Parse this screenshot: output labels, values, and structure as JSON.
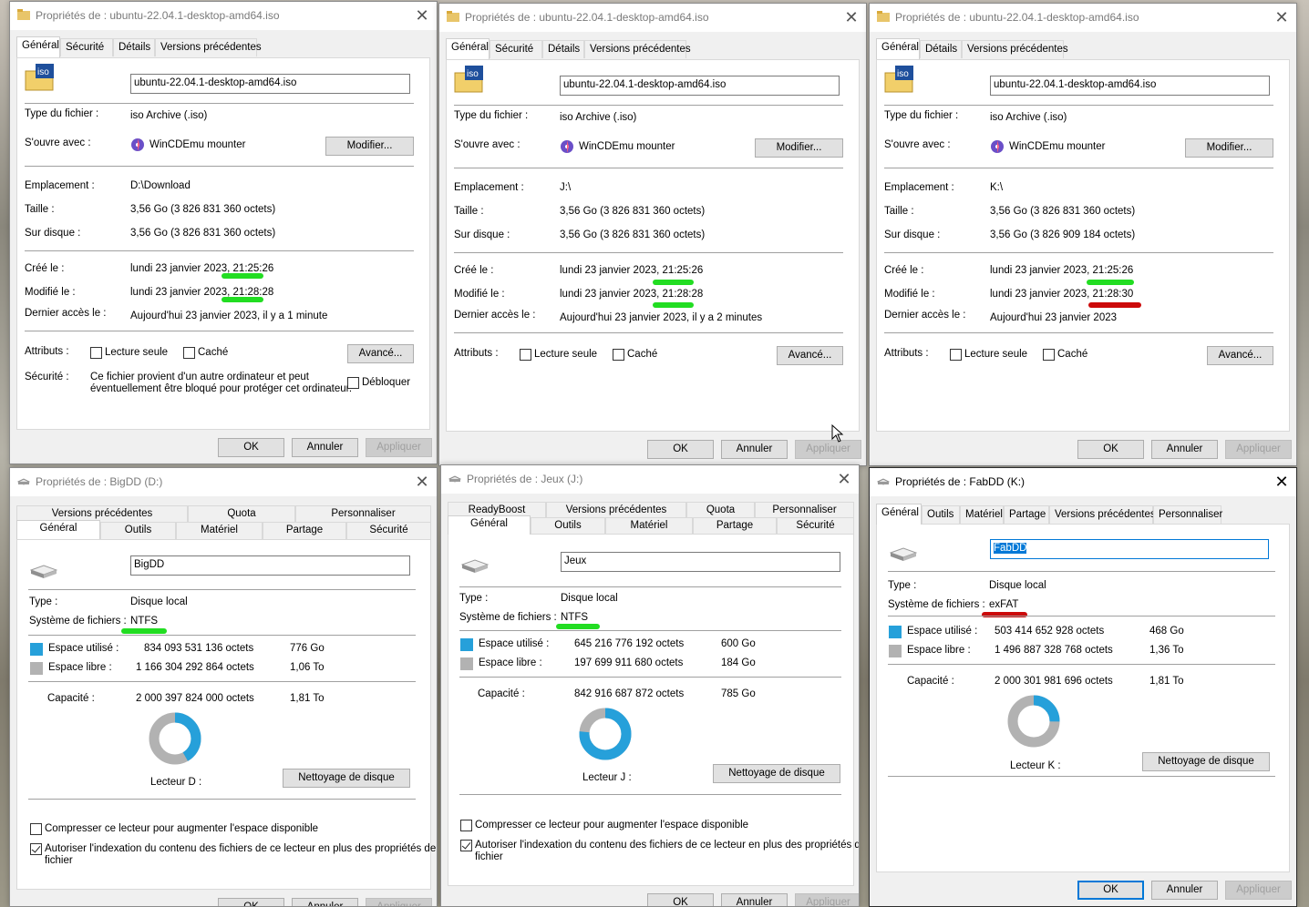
{
  "colors": {
    "used": "#26a0da",
    "free": "#b2b2b2",
    "highlight_green": "#22dd22",
    "highlight_red": "#cc0a0a",
    "focus": "#0078d7"
  },
  "labels": {
    "type_fichier": "Type du fichier :",
    "souvre_avec": "S'ouvre avec :",
    "emplacement": "Emplacement :",
    "taille": "Taille :",
    "sur_disque": "Sur disque :",
    "cree": "Créé le :",
    "modifie": "Modifié le :",
    "dernier_acces": "Dernier accès le :",
    "attributs": "Attributs :",
    "securite": "Sécurité :",
    "lecture_seule": "Lecture seule",
    "cache": "Caché",
    "avance": "Avancé...",
    "modifier": "Modifier...",
    "debloquer": "Débloquer",
    "type": "Type :",
    "systeme_fichiers": "Système de fichiers :",
    "espace_utilise": "Espace utilisé :",
    "espace_libre": "Espace libre :",
    "capacite": "Capacité :",
    "nettoyage": "Nettoyage de disque",
    "compresser": "Compresser ce lecteur pour augmenter l'espace disponible",
    "autoriser_1": "Autoriser l'indexation du contenu des fichiers de ce lecteur en plus des propriétés de",
    "autoriser_2": "fichier",
    "ok": "OK",
    "annuler": "Annuler",
    "appliquer": "Appliquer"
  },
  "file_windows": [
    {
      "title": "Propriétés de : ubuntu-22.04.1-desktop-amd64.iso",
      "tabs": [
        "Général",
        "Sécurité",
        "Détails",
        "Versions précédentes"
      ],
      "name": "ubuntu-22.04.1-desktop-amd64.iso",
      "type": "iso Archive (.iso)",
      "opens_with": "WinCDEmu mounter",
      "location": "D:\\Download",
      "size": "3,56 Go (3 826 831 360 octets)",
      "on_disk": "3,56 Go (3 826 831 360 octets)",
      "created": "lundi 23 janvier 2023, 21:25:26",
      "modified": "lundi 23 janvier 2023, 21:28:28",
      "accessed": "Aujourd'hui 23 janvier 2023, il y a 1 minute",
      "security_1": "Ce fichier provient d'un autre ordinateur et peut",
      "security_2": "éventuellement être bloqué pour protéger cet ordinateur."
    },
    {
      "title": "Propriétés de : ubuntu-22.04.1-desktop-amd64.iso",
      "tabs": [
        "Général",
        "Sécurité",
        "Détails",
        "Versions précédentes"
      ],
      "name": "ubuntu-22.04.1-desktop-amd64.iso",
      "type": "iso Archive (.iso)",
      "opens_with": "WinCDEmu mounter",
      "location": "J:\\",
      "size": "3,56 Go (3 826 831 360 octets)",
      "on_disk": "3,56 Go (3 826 831 360 octets)",
      "created": "lundi 23 janvier 2023, 21:25:26",
      "modified": "lundi 23 janvier 2023, 21:28:28",
      "accessed": "Aujourd'hui 23 janvier 2023, il y a 2 minutes"
    },
    {
      "title": "Propriétés de : ubuntu-22.04.1-desktop-amd64.iso",
      "tabs": [
        "Général",
        "Détails",
        "Versions précédentes"
      ],
      "name": "ubuntu-22.04.1-desktop-amd64.iso",
      "type": "iso Archive (.iso)",
      "opens_with": "WinCDEmu mounter",
      "location": "K:\\",
      "size": "3,56 Go (3 826 831 360 octets)",
      "on_disk": "3,56 Go (3 826 909 184 octets)",
      "created": "lundi 23 janvier 2023, 21:25:26",
      "modified": "lundi 23 janvier 2023, 21:28:30",
      "accessed": "Aujourd'hui 23 janvier 2023"
    }
  ],
  "drive_windows": [
    {
      "title": "Propriétés de : BigDD (D:)",
      "tabs_row1": [
        "Versions précédentes",
        "Quota",
        "Personnaliser"
      ],
      "tabs_row2": [
        "Général",
        "Outils",
        "Matériel",
        "Partage",
        "Sécurité"
      ],
      "name": "BigDD",
      "type": "Disque local",
      "fs": "NTFS",
      "used_bytes": "834 093 531 136 octets",
      "used_h": "776 Go",
      "free_bytes": "1 166 304 292 864 octets",
      "free_h": "1,06 To",
      "cap_bytes": "2 000 397 824 000 octets",
      "cap_h": "1,81 To",
      "used_fraction": 0.417,
      "drive_label": "Lecteur D :"
    },
    {
      "title": "Propriétés de : Jeux (J:)",
      "tabs_row1": [
        "ReadyBoost",
        "Versions précédentes",
        "Quota",
        "Personnaliser"
      ],
      "tabs_row2": [
        "Général",
        "Outils",
        "Matériel",
        "Partage",
        "Sécurité"
      ],
      "name": "Jeux",
      "type": "Disque local",
      "fs": "NTFS",
      "used_bytes": "645 216 776 192 octets",
      "used_h": "600 Go",
      "free_bytes": "197 699 911 680 octets",
      "free_h": "184 Go",
      "cap_bytes": "842 916 687 872 octets",
      "cap_h": "785 Go",
      "used_fraction": 0.765,
      "drive_label": "Lecteur J :"
    },
    {
      "title": "Propriétés de : FabDD (K:)",
      "tabs": [
        "Général",
        "Outils",
        "Matériel",
        "Partage",
        "Versions précédentes",
        "Personnaliser"
      ],
      "name": "FabDD",
      "type": "Disque local",
      "fs": "exFAT",
      "used_bytes": "503 414 652 928 octets",
      "used_h": "468 Go",
      "free_bytes": "1 496 887 328 768 octets",
      "free_h": "1,36 To",
      "cap_bytes": "2 000 301 981 696 octets",
      "cap_h": "1,81 To",
      "used_fraction": 0.252,
      "drive_label": "Lecteur K :"
    }
  ]
}
